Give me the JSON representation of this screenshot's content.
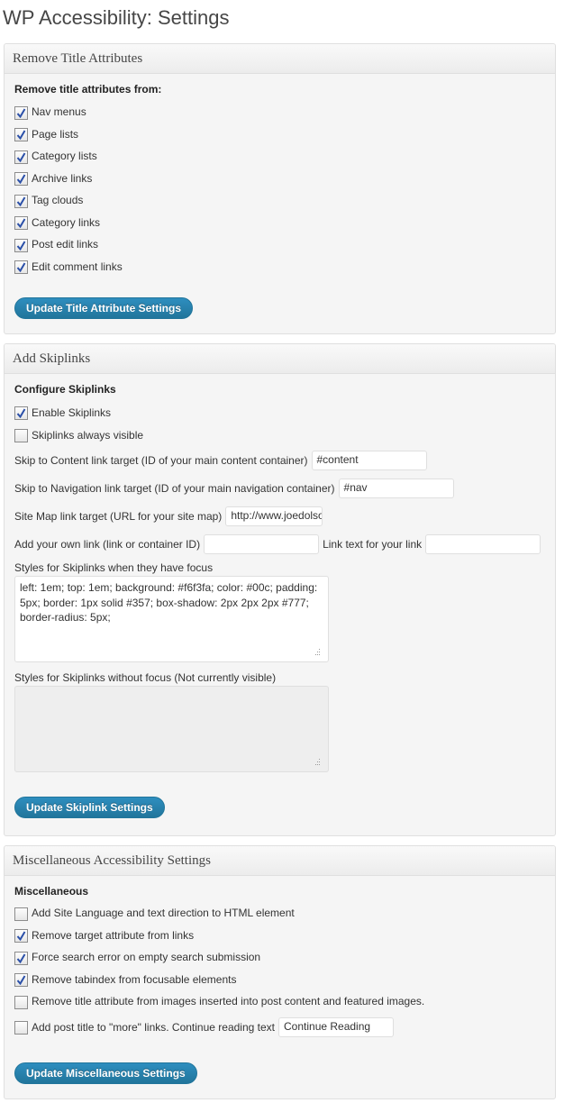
{
  "page": {
    "title": "WP Accessibility: Settings"
  },
  "colors": {
    "button": "#21759b",
    "check": "#2a4fa8"
  },
  "sections": {
    "title_attrs": {
      "heading": "Remove Title Attributes",
      "subheading": "Remove title attributes from:",
      "options": [
        {
          "label": "Nav menus",
          "checked": true
        },
        {
          "label": "Page lists",
          "checked": true
        },
        {
          "label": "Category lists",
          "checked": true
        },
        {
          "label": "Archive links",
          "checked": true
        },
        {
          "label": "Tag clouds",
          "checked": true
        },
        {
          "label": "Category links",
          "checked": true
        },
        {
          "label": "Post edit links",
          "checked": true
        },
        {
          "label": "Edit comment links",
          "checked": true
        }
      ],
      "submit_label": "Update Title Attribute Settings"
    },
    "skiplinks": {
      "heading": "Add Skiplinks",
      "subheading": "Configure Skiplinks",
      "options": [
        {
          "label": "Enable Skiplinks",
          "checked": true
        },
        {
          "label": "Skiplinks always visible",
          "checked": false
        }
      ],
      "content_target": {
        "label": "Skip to Content link target (ID of your main content container)",
        "value": "#content"
      },
      "nav_target": {
        "label": "Skip to Navigation link target (ID of your main navigation container)",
        "value": "#nav"
      },
      "sitemap_target": {
        "label": "Site Map link target (URL for your site map)",
        "value": "http://www.joedolson.c"
      },
      "own_link": {
        "label": "Add your own link (link or container ID)",
        "value": ""
      },
      "own_link_text": {
        "label": "Link text for your link",
        "value": ""
      },
      "focus_styles": {
        "label": "Styles for Skiplinks when they have focus",
        "value": "left: 1em; top: 1em; background: #f6f3fa; color: #00c; padding: 5px; border: 1px solid #357; box-shadow: 2px 2px 2px #777; border-radius: 5px;"
      },
      "unfocus_styles": {
        "label": "Styles for Skiplinks without focus (Not currently visible)",
        "value": ""
      },
      "submit_label": "Update Skiplink Settings"
    },
    "misc": {
      "heading": "Miscellaneous Accessibility Settings",
      "subheading": "Miscellaneous",
      "options": [
        {
          "label": "Add Site Language and text direction to HTML element",
          "checked": false
        },
        {
          "label": "Remove target attribute from links",
          "checked": true
        },
        {
          "label": "Force search error on empty search submission",
          "checked": true
        },
        {
          "label": "Remove tabindex from focusable elements",
          "checked": true
        },
        {
          "label": "Remove title attribute from images inserted into post content and featured images.",
          "checked": false
        },
        {
          "label": "Add post title to \"more\" links. Continue reading text",
          "checked": false
        }
      ],
      "continue_reading_value": "Continue Reading",
      "submit_label": "Update Miscellaneous Settings"
    }
  }
}
